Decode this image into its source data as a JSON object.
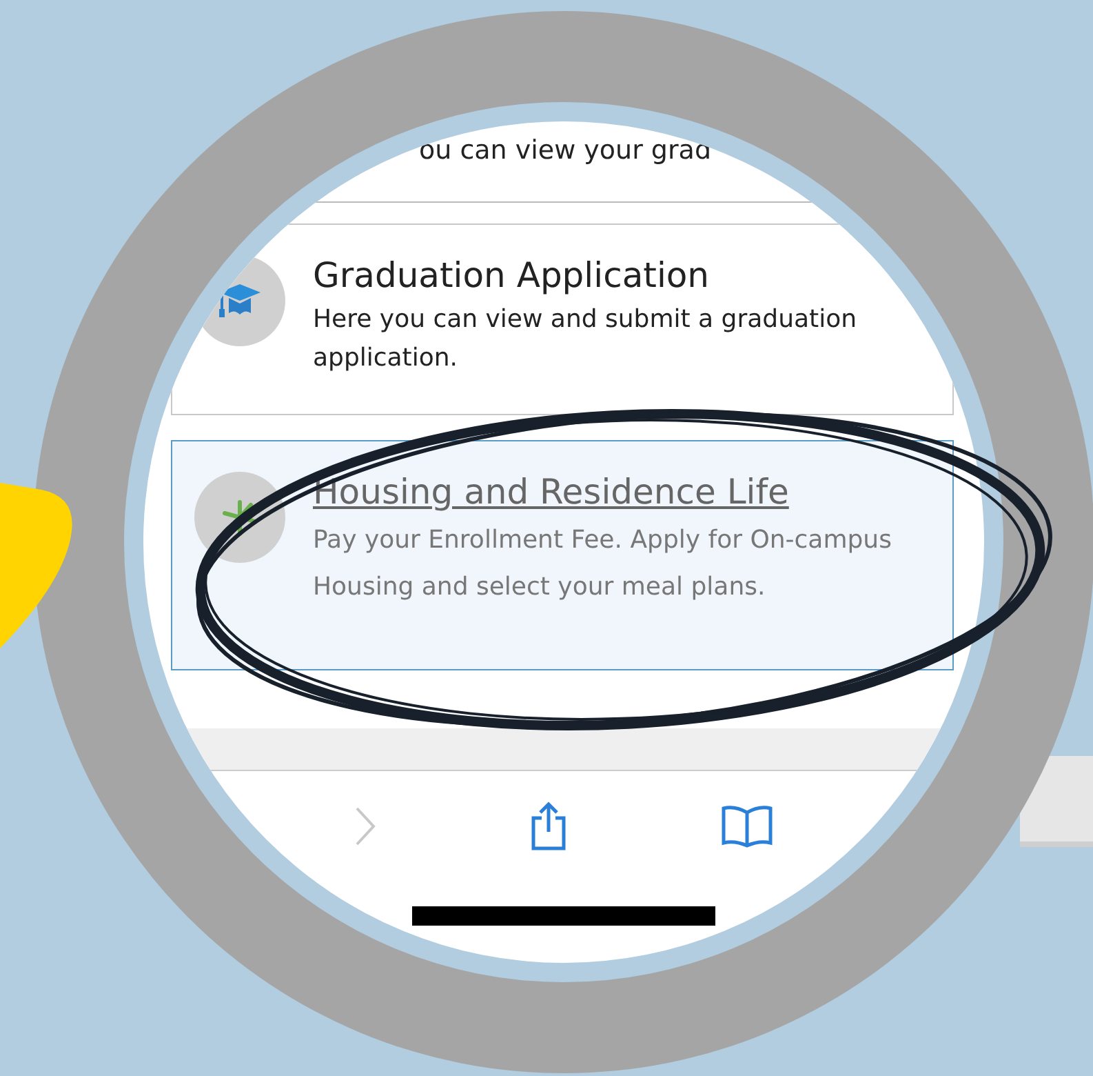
{
  "cut_text": "ou can view your grad",
  "cards": [
    {
      "kind": "graduation",
      "title": "Graduation Application",
      "description": "Here you can view and submit a graduation application.",
      "selected": false
    },
    {
      "kind": "housing",
      "title": "Housing and Residence Life",
      "description": "Pay your Enrollment Fee. Apply for On-campus Housing and select your meal plans.",
      "selected": true
    }
  ],
  "toolbar": {
    "forward_disabled": true
  }
}
